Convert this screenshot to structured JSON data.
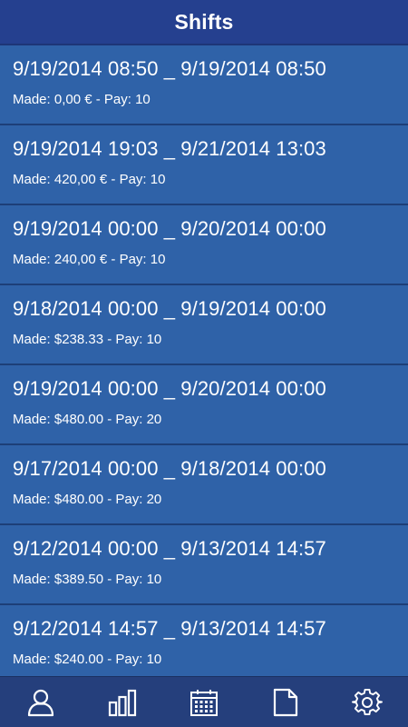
{
  "header": {
    "title": "Shifts"
  },
  "shifts": [
    {
      "range": "9/19/2014 08:50 _ 9/19/2014 08:50",
      "detail": "Made: 0,00 € - Pay: 10"
    },
    {
      "range": "9/19/2014 19:03 _ 9/21/2014 13:03",
      "detail": "Made: 420,00 € - Pay: 10"
    },
    {
      "range": "9/19/2014 00:00 _ 9/20/2014 00:00",
      "detail": "Made: 240,00 € - Pay: 10"
    },
    {
      "range": "9/18/2014 00:00 _ 9/19/2014 00:00",
      "detail": "Made: $238.33 - Pay: 10"
    },
    {
      "range": "9/19/2014 00:00 _ 9/20/2014 00:00",
      "detail": "Made: $480.00 - Pay: 20"
    },
    {
      "range": "9/17/2014 00:00 _ 9/18/2014 00:00",
      "detail": "Made: $480.00 - Pay: 20"
    },
    {
      "range": "9/12/2014 00:00 _ 9/13/2014 14:57",
      "detail": "Made: $389.50 - Pay: 10"
    },
    {
      "range": "9/12/2014 14:57 _ 9/13/2014 14:57",
      "detail": "Made: $240.00 - Pay: 10"
    }
  ],
  "bottom_nav": {
    "items": [
      {
        "icon": "user-icon"
      },
      {
        "icon": "bar-chart-icon"
      },
      {
        "icon": "calendar-icon"
      },
      {
        "icon": "document-icon"
      },
      {
        "icon": "gear-icon"
      }
    ]
  },
  "colors": {
    "header_bg": "#25408f",
    "item_bg": "#2f62a8",
    "divider": "#1d3f78",
    "nav_bg": "#253f7c",
    "text": "#ffffff"
  }
}
